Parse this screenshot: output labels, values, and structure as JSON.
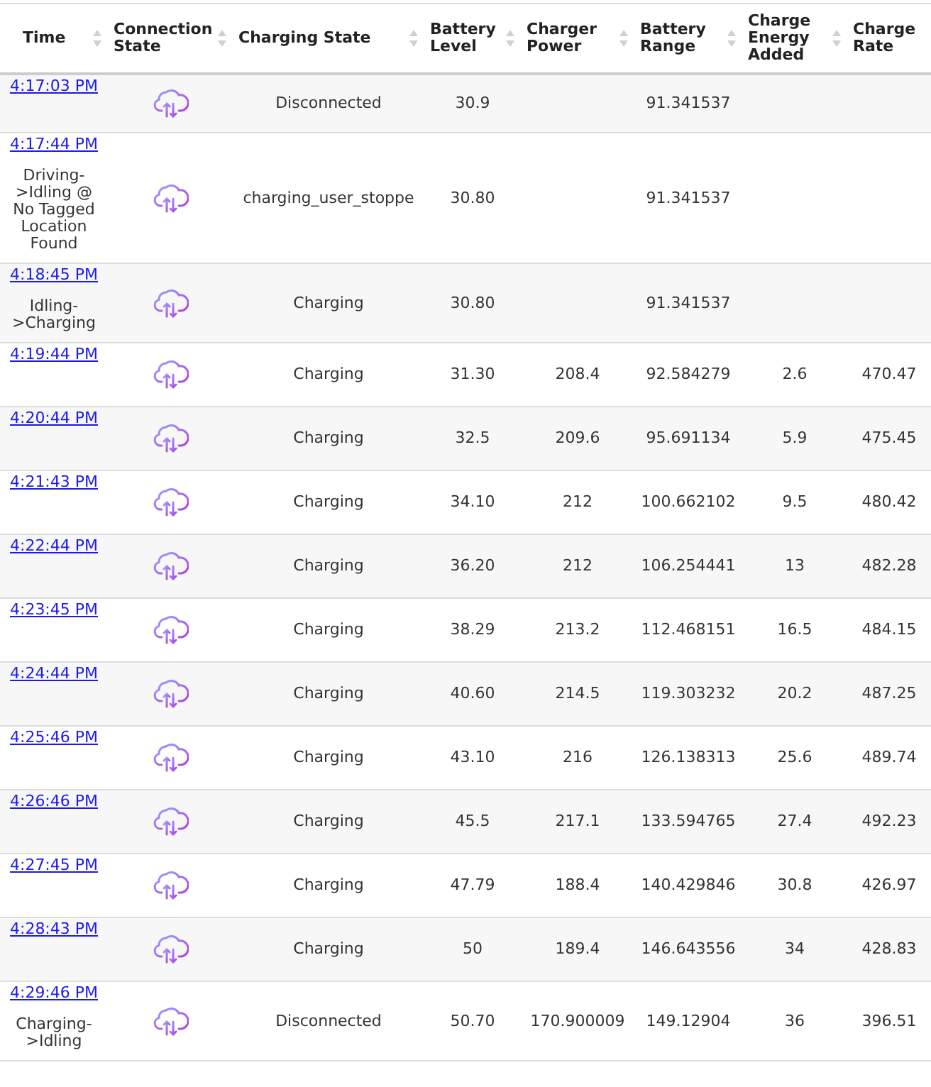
{
  "table": {
    "columns": [
      {
        "label": "Time"
      },
      {
        "label": "Connection State"
      },
      {
        "label": "Charging State"
      },
      {
        "label": "Battery Level"
      },
      {
        "label": "Charger Power"
      },
      {
        "label": "Battery Range"
      },
      {
        "label": "Charge Energy Added"
      },
      {
        "label": "Charge Rate"
      }
    ],
    "rows": [
      {
        "time": "4:17:03 PM",
        "charging_state": "Disconnected",
        "battery_level": "30.9",
        "battery_range": "91.341537"
      },
      {
        "time": "4:17:44 PM",
        "note": "Driving->Idling @ No Tagged Location Found",
        "charging_state": "charging_user_stoppe",
        "battery_level": "30.80",
        "battery_range": "91.341537"
      },
      {
        "time": "4:18:45 PM",
        "note": "Idling->Charging",
        "charging_state": "Charging",
        "battery_level": "30.80",
        "battery_range": "91.341537"
      },
      {
        "time": "4:19:44 PM",
        "charging_state": "Charging",
        "battery_level": "31.30",
        "charger_power": "208.4",
        "battery_range": "92.584279",
        "energy_added": "2.6",
        "charge_rate": "470.47"
      },
      {
        "time": "4:20:44 PM",
        "charging_state": "Charging",
        "battery_level": "32.5",
        "charger_power": "209.6",
        "battery_range": "95.691134",
        "energy_added": "5.9",
        "charge_rate": "475.45"
      },
      {
        "time": "4:21:43 PM",
        "charging_state": "Charging",
        "battery_level": "34.10",
        "charger_power": "212",
        "battery_range": "100.662102",
        "energy_added": "9.5",
        "charge_rate": "480.42"
      },
      {
        "time": "4:22:44 PM",
        "charging_state": "Charging",
        "battery_level": "36.20",
        "charger_power": "212",
        "battery_range": "106.254441",
        "energy_added": "13",
        "charge_rate": "482.28"
      },
      {
        "time": "4:23:45 PM",
        "charging_state": "Charging",
        "battery_level": "38.29",
        "charger_power": "213.2",
        "battery_range": "112.468151",
        "energy_added": "16.5",
        "charge_rate": "484.15"
      },
      {
        "time": "4:24:44 PM",
        "charging_state": "Charging",
        "battery_level": "40.60",
        "charger_power": "214.5",
        "battery_range": "119.303232",
        "energy_added": "20.2",
        "charge_rate": "487.25"
      },
      {
        "time": "4:25:46 PM",
        "charging_state": "Charging",
        "battery_level": "43.10",
        "charger_power": "216",
        "battery_range": "126.138313",
        "energy_added": "25.6",
        "charge_rate": "489.74"
      },
      {
        "time": "4:26:46 PM",
        "charging_state": "Charging",
        "battery_level": "45.5",
        "charger_power": "217.1",
        "battery_range": "133.594765",
        "energy_added": "27.4",
        "charge_rate": "492.23"
      },
      {
        "time": "4:27:45 PM",
        "charging_state": "Charging",
        "battery_level": "47.79",
        "charger_power": "188.4",
        "battery_range": "140.429846",
        "energy_added": "30.8",
        "charge_rate": "426.97"
      },
      {
        "time": "4:28:43 PM",
        "charging_state": "Charging",
        "battery_level": "50",
        "charger_power": "189.4",
        "battery_range": "146.643556",
        "energy_added": "34",
        "charge_rate": "428.83"
      },
      {
        "time": "4:29:46 PM",
        "note": "Charging->Idling",
        "charging_state": "Disconnected",
        "battery_level": "50.70",
        "charger_power": "170.900009",
        "battery_range": "149.12904",
        "energy_added": "36",
        "charge_rate": "396.51"
      }
    ]
  }
}
